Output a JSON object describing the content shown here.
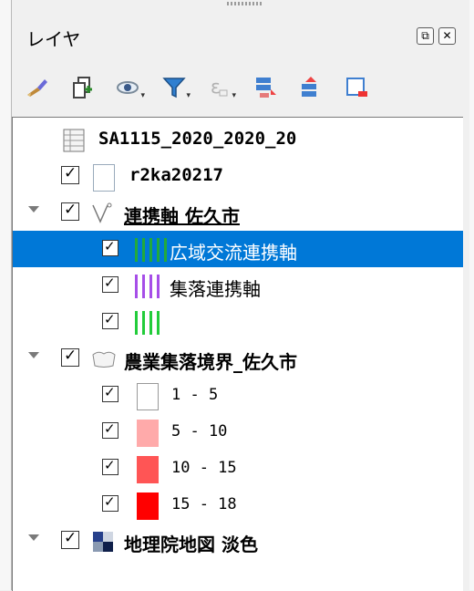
{
  "dock": {
    "title": "レイヤ"
  },
  "toolbar": {
    "icons": [
      "style-brush-icon",
      "add-group-icon",
      "visibility-eye-icon",
      "filter-legend-icon",
      "filter-expression-icon",
      "expand-all-icon",
      "collapse-all-icon",
      "remove-layer-icon"
    ]
  },
  "layers": {
    "raster_table": {
      "label": "SA1115_2020_2020_20"
    },
    "r2ka": {
      "label": "r2ka20217"
    },
    "renkei": {
      "label": "連携軸 佐久市",
      "classes": [
        {
          "label": "広域交流連携軸",
          "color": "#22aa3a"
        },
        {
          "label": "集落連携軸",
          "color": "#a64ee8"
        },
        {
          "label": "",
          "color": "#22cc3a"
        }
      ]
    },
    "nogyo": {
      "label": "農業集落境界_佐久市",
      "classes": [
        {
          "label": "1 - 5",
          "color": "#ffffff"
        },
        {
          "label": "5 - 10",
          "color": "#ffaaaa"
        },
        {
          "label": "10 - 15",
          "color": "#ff5555"
        },
        {
          "label": "15 - 18",
          "color": "#ff0000"
        }
      ]
    },
    "chiriin": {
      "label": "地理院地図 淡色"
    }
  },
  "colors": {
    "selection": "#0078d7"
  }
}
